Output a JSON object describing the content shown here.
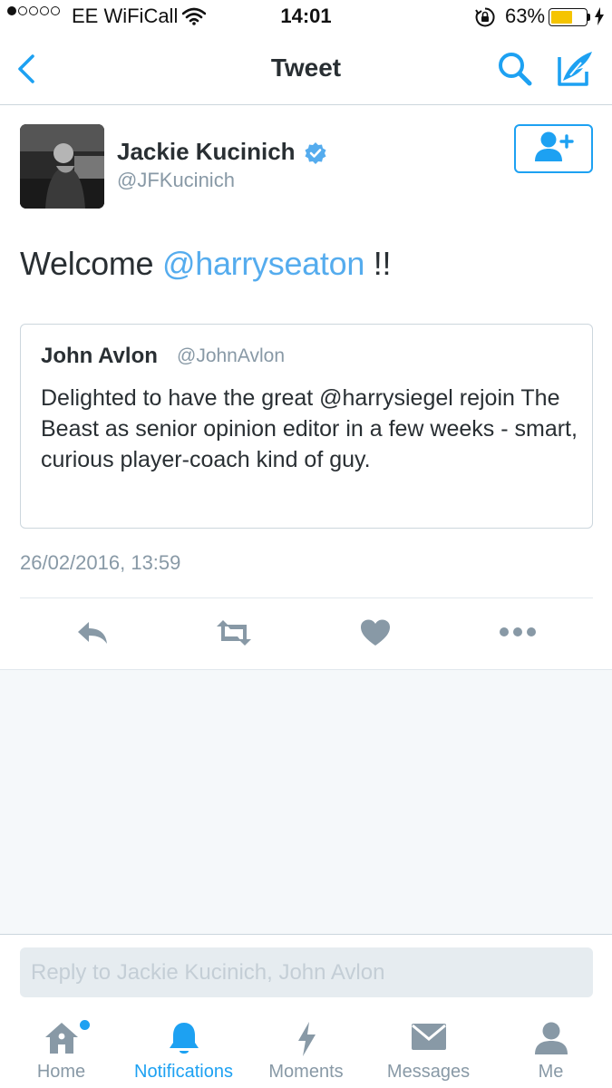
{
  "status_bar": {
    "carrier": "EE WiFiCall",
    "time": "14:01",
    "battery_percent": "63%",
    "battery_level": 0.63,
    "signal_bars_filled": 1,
    "signal_bars_total": 5
  },
  "nav": {
    "title": "Tweet",
    "back_icon": "chevron-left-icon",
    "search_icon": "search-icon",
    "compose_icon": "compose-icon"
  },
  "tweet": {
    "author_name": "Jackie Kucinich",
    "author_handle": "@JFKucinich",
    "verified": true,
    "text_prefix": "Welcome ",
    "text_mention": "@harryseaton",
    "text_suffix": " !!",
    "timestamp": "26/02/2016, 13:59"
  },
  "quoted_tweet": {
    "author_name": "John Avlon",
    "author_handle": "@JohnAvlon",
    "text": "Delighted to have the great @harrysiegel rejoin The Beast as senior opinion editor in a few weeks - smart, curious player-coach kind of guy."
  },
  "reply": {
    "placeholder": "Reply to Jackie Kucinich, John Avlon"
  },
  "tabs": [
    {
      "label": "Home",
      "icon": "home-icon",
      "active": false,
      "badge": true
    },
    {
      "label": "Notifications",
      "icon": "bell-icon",
      "active": true,
      "badge": false
    },
    {
      "label": "Moments",
      "icon": "lightning-icon",
      "active": false,
      "badge": false
    },
    {
      "label": "Messages",
      "icon": "envelope-icon",
      "active": false,
      "badge": false
    },
    {
      "label": "Me",
      "icon": "person-icon",
      "active": false,
      "badge": false
    }
  ],
  "colors": {
    "accent": "#1da1f2",
    "mention": "#55acee",
    "muted": "#8899a6",
    "text": "#292f33",
    "battery": "#f5c400"
  }
}
